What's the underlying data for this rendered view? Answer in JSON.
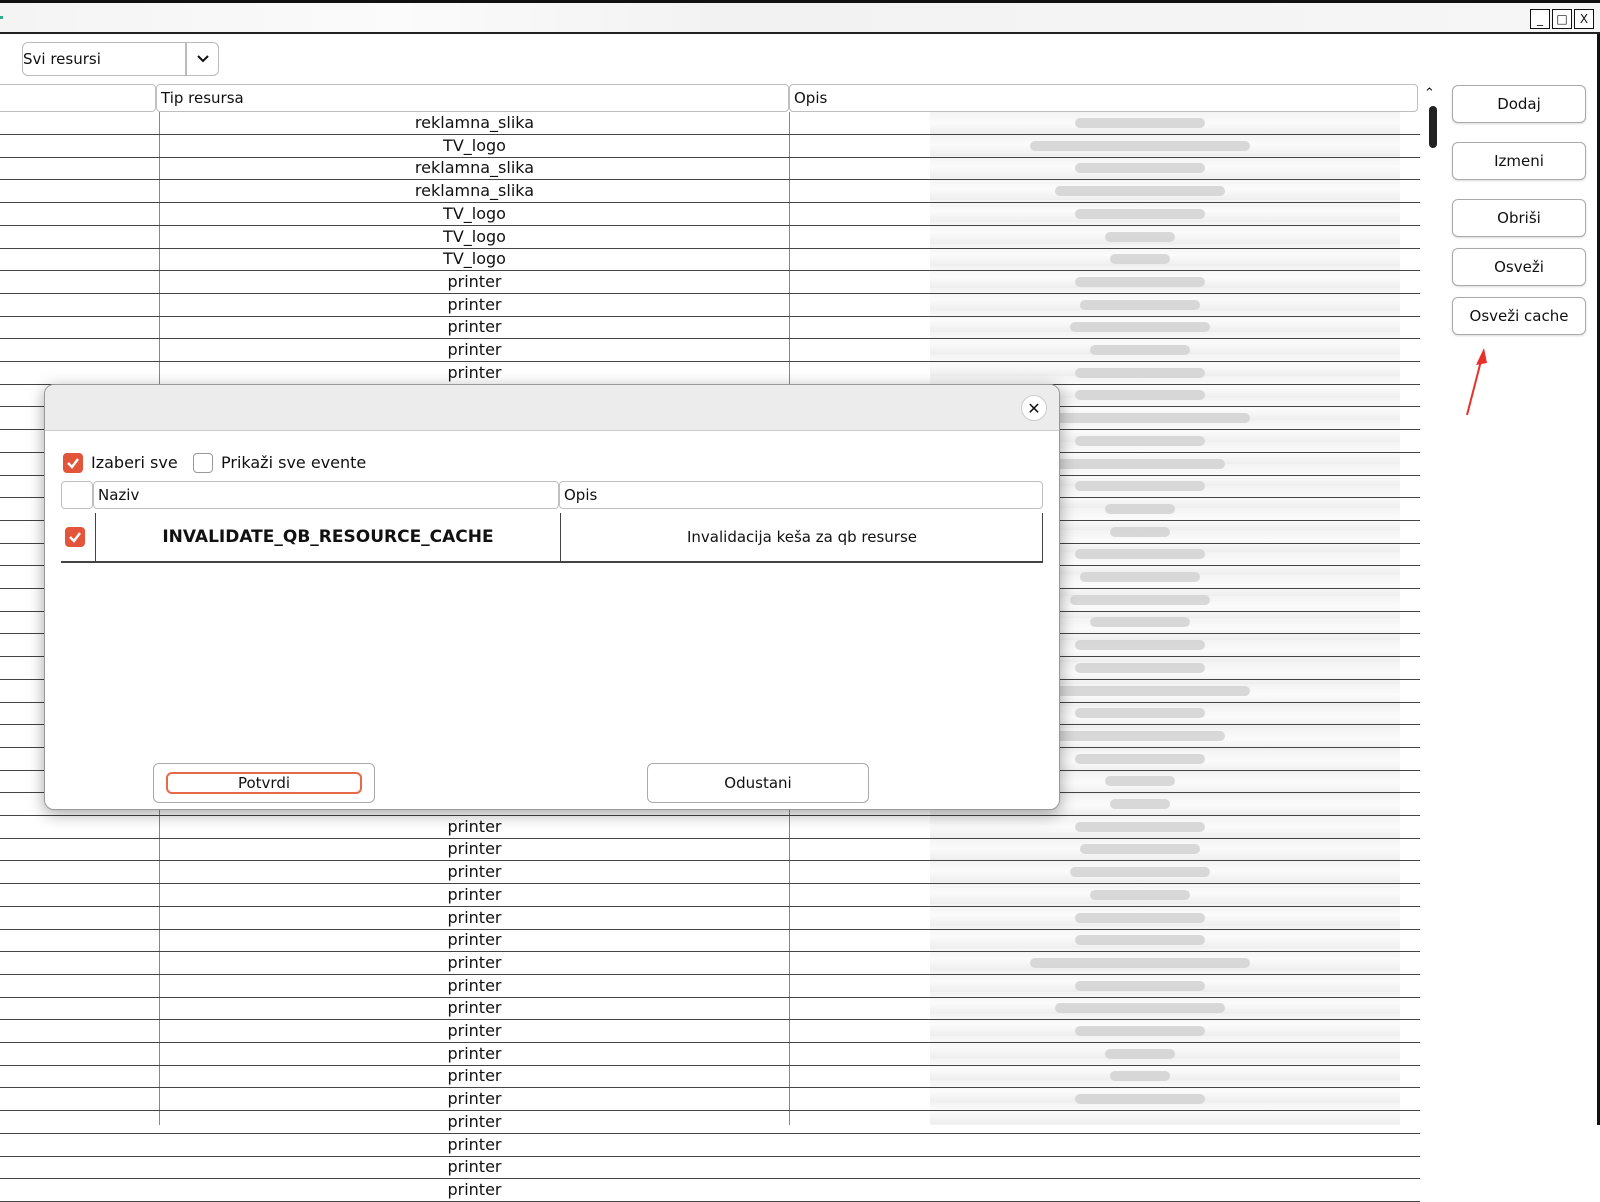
{
  "window": {
    "controls": [
      "_",
      "□",
      "X"
    ]
  },
  "filter": {
    "selected": "Svi resursi"
  },
  "grid": {
    "columns": [
      "Tip resursa",
      "Opis"
    ],
    "rows": [
      "reklamna_slika",
      "TV_logo",
      "reklamna_slika",
      "reklamna_slika",
      "TV_logo",
      "TV_logo",
      "TV_logo",
      "printer",
      "printer",
      "printer",
      "printer",
      "printer",
      "",
      "",
      "",
      "",
      "",
      "",
      "",
      "",
      "",
      "",
      "",
      "",
      "",
      "",
      "",
      "",
      "",
      "",
      "",
      "printer",
      "printer",
      "printer",
      "printer",
      "printer",
      "printer",
      "printer",
      "printer",
      "printer",
      "printer",
      "printer",
      "printer",
      "printer",
      "printer",
      "printer",
      "printer",
      "printer"
    ]
  },
  "sidebar": {
    "add": "Dodaj",
    "edit": "Izmeni",
    "delete": "Obriši",
    "refresh": "Osveži",
    "refresh_cache": "Osveži cache"
  },
  "dialog": {
    "select_all": "Izaberi sve",
    "show_all_events": "Prikaži sve evente",
    "columns": {
      "name": "Naziv",
      "desc": "Opis"
    },
    "row": {
      "name": "INVALIDATE_QB_RESOURCE_CACHE",
      "desc": "Invalidacija keša za qb resurse",
      "checked": true
    },
    "confirm": "Potvrdi",
    "cancel": "Odustani"
  },
  "colors": {
    "accent": "#e2553b",
    "annotation_arrow": "#e8302a"
  }
}
